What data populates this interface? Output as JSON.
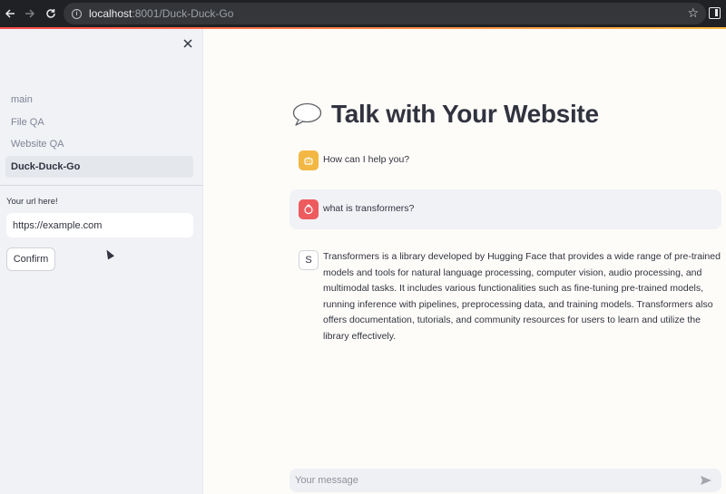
{
  "browser": {
    "url_host": "localhost",
    "url_rest": ":8001/Duck-Duck-Go"
  },
  "sidebar": {
    "nav_items": [
      {
        "label": "main"
      },
      {
        "label": "File QA"
      },
      {
        "label": "Website QA"
      },
      {
        "label": "Duck-Duck-Go"
      }
    ],
    "url_label": "Your url here!",
    "url_value": "https://example.com",
    "confirm_label": "Confirm"
  },
  "main": {
    "title": "Talk with Your Website",
    "messages": [
      {
        "role": "assistant",
        "text": "How can I help you?"
      },
      {
        "role": "user",
        "text": "what is transformers?"
      },
      {
        "role": "assistant",
        "avatar_letter": "S",
        "text": "Transformers is a library developed by Hugging Face that provides a wide range of pre-trained models and tools for natural language processing, computer vision, audio processing, and multimodal tasks. It includes various functionalities such as fine-tuning pre-trained models, running inference with pipelines, preprocessing data, and training models. Transformers also offers documentation, tutorials, and community resources for users to learn and utilize the library effectively."
      }
    ],
    "chat_placeholder": "Your message"
  },
  "colors": {
    "accent_start": "#ff4b4b",
    "accent_end": "#ffbd45",
    "assistant_avatar": "#f3b744",
    "user_avatar": "#ee5b5e",
    "sidebar_bg": "#f0f2f6"
  },
  "icons": [
    "back-icon",
    "forward-icon",
    "reload-icon",
    "info-icon",
    "star-icon",
    "side-panel-icon",
    "close-icon",
    "speech-balloon-icon",
    "bot-icon",
    "user-icon",
    "send-icon"
  ]
}
